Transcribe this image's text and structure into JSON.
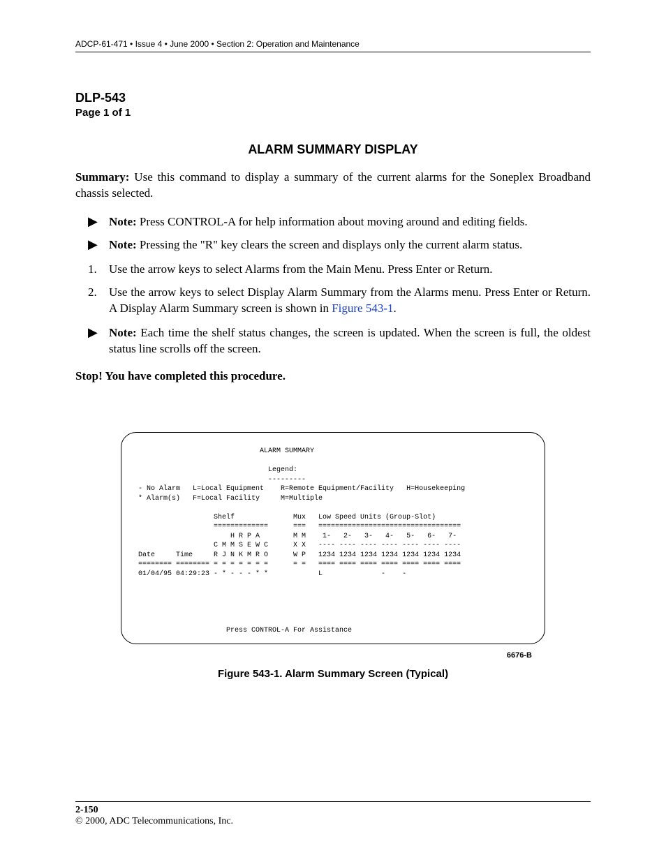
{
  "header": "ADCP-61-471 • Issue 4 • June 2000 • Section 2: Operation and Maintenance",
  "dlp": {
    "id": "DLP-543",
    "page": "Page 1 of 1"
  },
  "title": "ALARM SUMMARY DISPLAY",
  "summary": {
    "label": "Summary:",
    "text": "Use this command to display a summary of the current alarms for the Soneplex Broadband chassis selected."
  },
  "notes": {
    "a": {
      "label": "Note:",
      "text": "Press CONTROL-A for help information about moving around and editing fields."
    },
    "b": {
      "label": "Note:",
      "text": "Pressing the \"R\" key clears the screen and displays only the current alarm status."
    },
    "c": {
      "label": "Note:",
      "text": "Each time the shelf status changes, the screen is updated. When the screen is full, the oldest status line scrolls off the screen."
    }
  },
  "steps": {
    "s1": "Use the arrow keys to select Alarms from the Main Menu. Press Enter or Return.",
    "s2a": "Use the arrow keys to select Display Alarm Summary from the Alarms menu. Press Enter or Return. A Display Alarm Summary screen is shown in ",
    "s2link": "Figure 543-1",
    "s2b": "."
  },
  "stop": "Stop! You have completed this procedure.",
  "terminal": "                              ALARM SUMMARY\n\n                                Legend:\n                                ---------\n - No Alarm   L=Local Equipment    R=Remote Equipment/Facility   H=Housekeeping\n * Alarm(s)   F=Local Facility     M=Multiple\n\n                   Shelf              Mux   Low Speed Units (Group-Slot)\n                   =============      ===   ==================================\n                       H R P A        M M    1-   2-   3-   4-   5-   6-   7-\n                   C M M S E W C      X X   ---- ---- ---- ---- ---- ---- ----\n Date     Time     R J N K M R O      W P   1234 1234 1234 1234 1234 1234 1234\n ======== ======== = = = = = = =      = =   ==== ==== ==== ==== ==== ==== ====\n 01/04/95 04:29:23 - * - - - * *            L              -    -\n\n\n\n\n\n                      Press CONTROL-A For Assistance",
  "figure": {
    "no": "6676-B",
    "caption": "Figure 543-1. Alarm Summary Screen (Typical)"
  },
  "footer": {
    "page": "2-150",
    "copy": "© 2000, ADC Telecommunications, Inc."
  }
}
